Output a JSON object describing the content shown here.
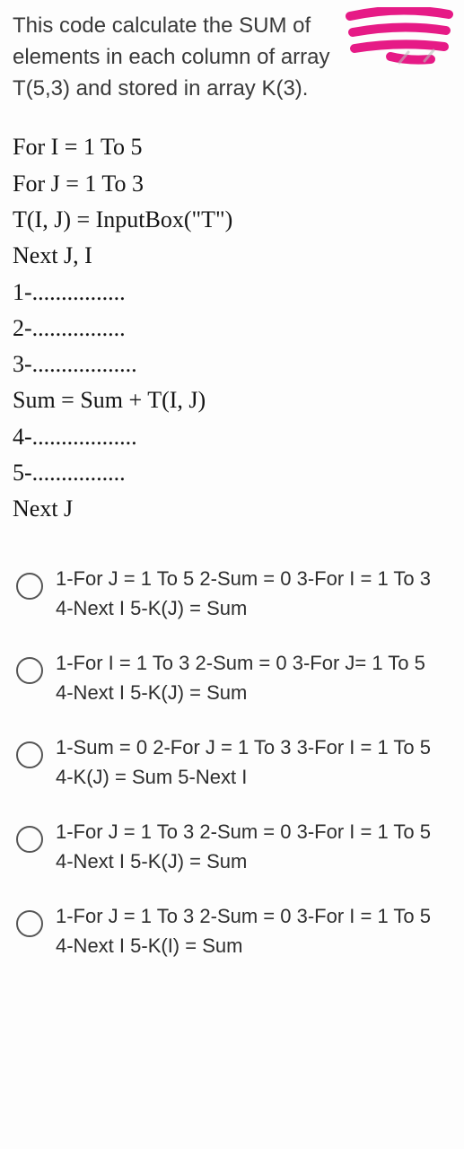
{
  "intro": "This code calculate the SUM of elements  in each column of array T(5,3) and stored in array K(3).",
  "code_lines": [
    "For I = 1 To 5",
    "For J = 1 To 3",
    "T(I, J) = InputBox(\"T\")",
    "Next J, I",
    "1-................",
    "2-................",
    "3-..................",
    "Sum = Sum + T(I, J)",
    "4-..................",
    "5-................",
    "Next J"
  ],
  "options": [
    "1-For J = 1 To 5 2-Sum = 0 3-For I = 1 To 3 4-Next I 5-K(J) = Sum",
    "1-For I = 1 To 3 2-Sum = 0 3-For J= 1 To 5 4-Next I 5-K(J) = Sum",
    "1-Sum = 0 2-For J = 1 To 3 3-For I = 1 To 5 4-K(J) = Sum 5-Next I",
    "1-For J = 1 To 3 2-Sum = 0 3-For I = 1 To 5 4-Next I 5-K(J) = Sum",
    "1-For J = 1 To 3 2-Sum = 0 3-For I = 1 To 5 4-Next I 5-K(I) = Sum"
  ]
}
